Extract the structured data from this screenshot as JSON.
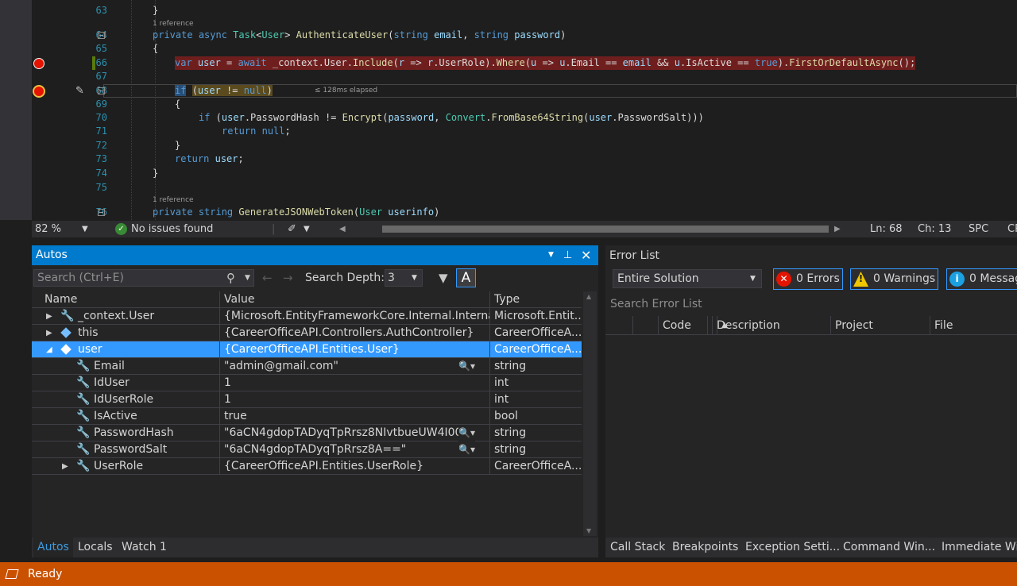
{
  "editor": {
    "lines": [
      {
        "num": "63"
      },
      {
        "codelens": "1 reference"
      },
      {
        "num": "64"
      },
      {
        "num": "65"
      },
      {
        "num": "66"
      },
      {
        "num": "67"
      },
      {
        "num": "68",
        "elapsed": "≤ 128ms elapsed"
      },
      {
        "num": "69"
      },
      {
        "num": "70"
      },
      {
        "num": "71"
      },
      {
        "num": "72"
      },
      {
        "num": "73"
      },
      {
        "num": "74"
      },
      {
        "num": "75"
      },
      {
        "codelens": "1 reference"
      },
      {
        "num": "76"
      }
    ]
  },
  "editor_status": {
    "zoom": "82 %",
    "issues": "No issues found",
    "ln": "Ln: 68",
    "ch": "Ch: 13",
    "spc": "SPC",
    "crlf": "CR"
  },
  "autos": {
    "title": "Autos",
    "search_placeholder": "Search (Ctrl+E)",
    "depth_label": "Search Depth:",
    "depth_value": "3",
    "columns": {
      "name": "Name",
      "value": "Value",
      "type": "Type"
    },
    "rows": [
      {
        "name": "_context.User",
        "value": "{Microsoft.EntityFrameworkCore.Internal.Internal...",
        "type": "Microsoft.Entit..."
      },
      {
        "name": "this",
        "value": "{CareerOfficeAPI.Controllers.AuthController}",
        "type": "CareerOfficeA..."
      },
      {
        "name": "user",
        "value": "{CareerOfficeAPI.Entities.User}",
        "type": "CareerOfficeA..."
      },
      {
        "name": "Email",
        "value": "\"admin@gmail.com\"",
        "type": "string"
      },
      {
        "name": "IdUser",
        "value": "1",
        "type": "int"
      },
      {
        "name": "IdUserRole",
        "value": "1",
        "type": "int"
      },
      {
        "name": "IsActive",
        "value": "true",
        "type": "bool"
      },
      {
        "name": "PasswordHash",
        "value": "\"6aCN4gdopTADyqTpRrsz8NIvtbueUW4I00...",
        "type": "string"
      },
      {
        "name": "PasswordSalt",
        "value": "\"6aCN4gdopTADyqTpRrsz8A==\"",
        "type": "string"
      },
      {
        "name": "UserRole",
        "value": "{CareerOfficeAPI.Entities.UserRole}",
        "type": "CareerOfficeA..."
      }
    ],
    "tabs": [
      "Autos",
      "Locals",
      "Watch 1"
    ]
  },
  "error_list": {
    "title": "Error List",
    "scope": "Entire Solution",
    "errors": "0 Errors",
    "warnings": "0 Warnings",
    "messages": "0 Messag",
    "search_placeholder": "Search Error List",
    "columns": {
      "code": "Code",
      "description": "Description",
      "project": "Project",
      "file": "File"
    },
    "tabs": [
      "Call Stack",
      "Breakpoints",
      "Exception Setti...",
      "Command Win...",
      "Immediate Wi"
    ]
  },
  "statusbar": {
    "text": "Ready"
  },
  "colors": {
    "accent": "#007acc",
    "status": "#ca5100",
    "selection": "#3399ff",
    "breakpoint": "#e51400"
  }
}
